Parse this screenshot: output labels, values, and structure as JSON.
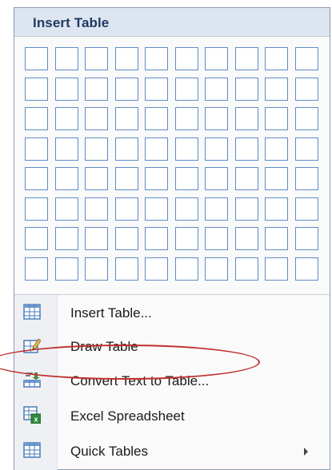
{
  "menu": {
    "title": "Insert Table",
    "grid": {
      "columns": 10,
      "rows": 8,
      "cell_border_color": "#5f8bc5"
    },
    "items": [
      {
        "label": "Insert Table...",
        "icon": "table-grid-icon",
        "has_submenu": false
      },
      {
        "label": "Draw Table",
        "icon": "pencil-table-icon",
        "has_submenu": false
      },
      {
        "label": "Convert Text to Table...",
        "icon": "convert-text-to-table-icon",
        "has_submenu": false,
        "highlighted": true
      },
      {
        "label": "Excel Spreadsheet",
        "icon": "excel-spreadsheet-icon",
        "has_submenu": false
      },
      {
        "label": "Quick Tables",
        "icon": "quick-tables-icon",
        "has_submenu": true
      }
    ]
  },
  "colors": {
    "header_background": "#dde5f0",
    "header_text": "#1f3b63",
    "highlight_ellipse": "#c0302e"
  }
}
